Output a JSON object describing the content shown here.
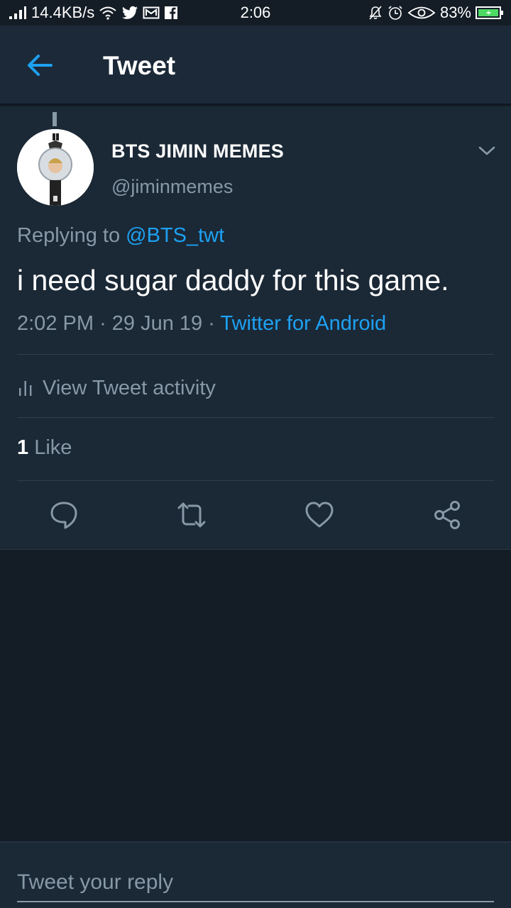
{
  "status_bar": {
    "speed": "14.4KB/s",
    "time": "2:06",
    "battery": "83%",
    "icons": [
      "signal-icon",
      "wifi-icon",
      "twitter-icon",
      "mail-icon",
      "facebook-icon",
      "mute-icon",
      "alarm-icon",
      "eye-icon",
      "battery-icon"
    ]
  },
  "header": {
    "back_icon": "arrow-left-icon",
    "title": "Tweet"
  },
  "tweet": {
    "author_name": "BTS JIMIN MEMES",
    "author_handle": "@jiminmemes",
    "replying_prefix": "Replying to",
    "replying_to": "@BTS_twt",
    "text": "i need sugar daddy for this game.",
    "time": "2:02 PM",
    "date": "29 Jun 19",
    "source": "Twitter for Android",
    "activity_label": "View Tweet activity",
    "like_count": "1",
    "like_label": "Like",
    "actions": [
      "reply-icon",
      "retweet-icon",
      "like-icon",
      "share-icon"
    ]
  },
  "composer": {
    "placeholder": "Tweet your reply"
  },
  "colors": {
    "background": "#141d26",
    "card": "#1b2836",
    "appbar": "#1c2938",
    "accent": "#1da1f2",
    "muted": "#8899a6"
  }
}
